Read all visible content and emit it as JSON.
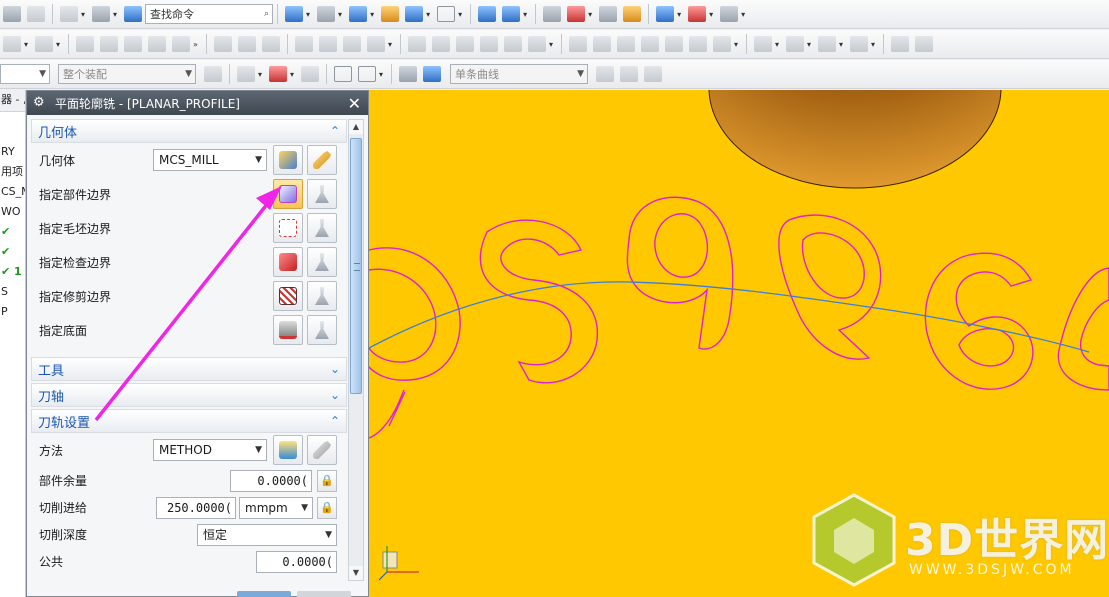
{
  "toolbar1": {
    "command_search_placeholder": "查找命令"
  },
  "toolbar3": {
    "filter_combo": "",
    "assembly_combo": "整个装配",
    "curve_rule_combo": "单条曲线"
  },
  "navigator": {
    "header_text": "器 - ,",
    "rows": [
      "RY",
      "用项",
      "CS_M",
      "WO",
      "✔",
      "✔",
      "✔ 1",
      "S",
      "P"
    ]
  },
  "dialog": {
    "title": "平面轮廓铣 - [PLANAR_PROFILE]",
    "geometry_section": "几何体",
    "geometry_label": "几何体",
    "geometry_value": "MCS_MILL",
    "specify_part_boundary": "指定部件边界",
    "specify_blank_boundary": "指定毛坯边界",
    "specify_check_boundary": "指定检查边界",
    "specify_trim_boundary": "指定修剪边界",
    "specify_floor": "指定底面",
    "tool_section": "工具",
    "axis_section": "刀轴",
    "path_section": "刀轨设置",
    "method_label": "方法",
    "method_value": "METHOD",
    "part_stock_label": "部件余量",
    "part_stock_value": "0.0000(",
    "feed_label": "切削进给",
    "feed_value": "250.0000(",
    "feed_unit": "mmpm",
    "depth_label": "切削深度",
    "depth_value": "恒定",
    "common_label": "公共",
    "common_value": "0.0000("
  },
  "watermark": {
    "brand": "3D世界网",
    "url": "WWW.3DSJW.COM"
  },
  "colors": {
    "viewport": "#ffc800",
    "profile": "#e020d0",
    "tool_path": "#3a7fd8",
    "arrow": "#f025e8"
  }
}
